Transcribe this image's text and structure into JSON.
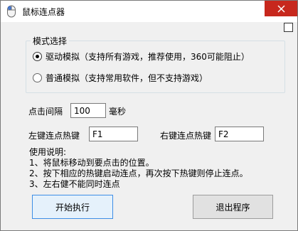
{
  "window": {
    "title": "鼠标连点器",
    "close_icon": "close-icon",
    "app_icon": "mouse-icon"
  },
  "mode": {
    "group_title": "模式选择",
    "options": [
      {
        "label": "驱动模拟（支持所有游戏，推荐使用，360可能阻止）",
        "selected": true
      },
      {
        "label": "普通模拟（支持常用软件，但不支持游戏）",
        "selected": false
      }
    ]
  },
  "interval": {
    "label": "点击间隔",
    "value": "100",
    "unit": "毫秒"
  },
  "hotkeys": {
    "left_label": "左键连点热键",
    "left_value": "F1",
    "right_label": "右键连点热键",
    "right_value": "F2"
  },
  "usage": {
    "title": "使用说明:",
    "lines": [
      "1、将鼠标移动到要点击的位置。",
      "2、按下相应的热键启动连点，再次按下热键则停止连点。",
      "3、左右健不能同时连点"
    ]
  },
  "buttons": {
    "start": "开始执行",
    "exit": "退出程序"
  },
  "colors": {
    "close_button": "#c7281d",
    "primary_border": "#3d8ee6"
  }
}
